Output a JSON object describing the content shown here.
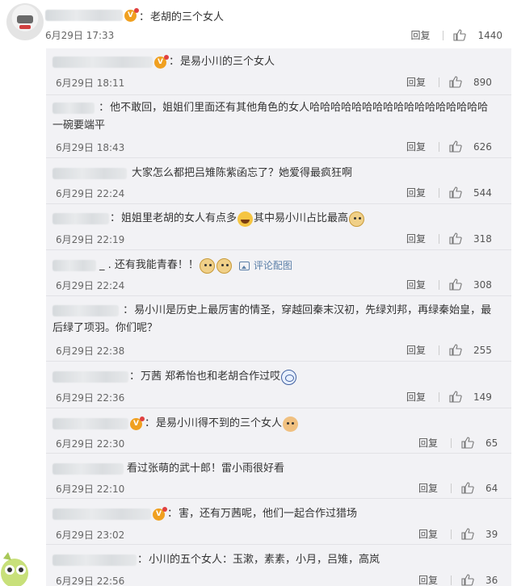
{
  "top_comment": {
    "text": "老胡的三个女人",
    "date": "6月29日 17:33",
    "reply_label": "回复",
    "likes": "1440"
  },
  "replies": [
    {
      "text": "是易小川的三个女人",
      "date": "6月29日 18:11",
      "reply_label": "回复",
      "likes": "890"
    },
    {
      "text": "他不敢回，姐姐们里面还有其他角色的女人哈哈哈哈哈哈哈哈哈哈哈哈哈哈哈哈哈 一碗要端平",
      "date": "6月29日 18:43",
      "reply_label": "回复",
      "likes": "626"
    },
    {
      "text": "大家怎么都把吕雉陈紫函忘了？她爱得最疯狂啊",
      "date": "6月29日 22:24",
      "reply_label": "回复",
      "likes": "544"
    },
    {
      "text_a": "姐姐里老胡的女人有点多",
      "text_b": "其中易小川占比最高",
      "date": "6月29日 22:19",
      "reply_label": "回复",
      "likes": "318"
    },
    {
      "text": "_ . 还有我能青春！！",
      "img_link": "评论配图",
      "date": "6月29日 22:24",
      "reply_label": "回复",
      "likes": "308"
    },
    {
      "text": "易小川是历史上最厉害的情圣，穿越回秦末汉初，先绿刘邦，再绿秦始皇，最后绿了项羽。你们呢？",
      "date": "6月29日 22:38",
      "reply_label": "回复",
      "likes": "255"
    },
    {
      "text": "万茜 郑希怡也和老胡合作过哎",
      "date": "6月29日 22:36",
      "reply_label": "回复",
      "likes": "149"
    },
    {
      "text": "是易小川得不到的三个女人",
      "date": "6月29日 22:30",
      "reply_label": "回复",
      "likes": "65"
    },
    {
      "text": "看过张萌的武十郎！雷小雨很好看",
      "date": "6月29日 22:10",
      "reply_label": "回复",
      "likes": "64"
    },
    {
      "text": "害，还有万茜呢，他们一起合作过猎场",
      "date": "6月29日 23:02",
      "reply_label": "回复",
      "likes": "39"
    },
    {
      "text": "小川的五个女人：玉漱，素素，小月，吕雉，高岚",
      "date": "6月29日 22:56",
      "reply_label": "回复",
      "likes": "36"
    }
  ]
}
